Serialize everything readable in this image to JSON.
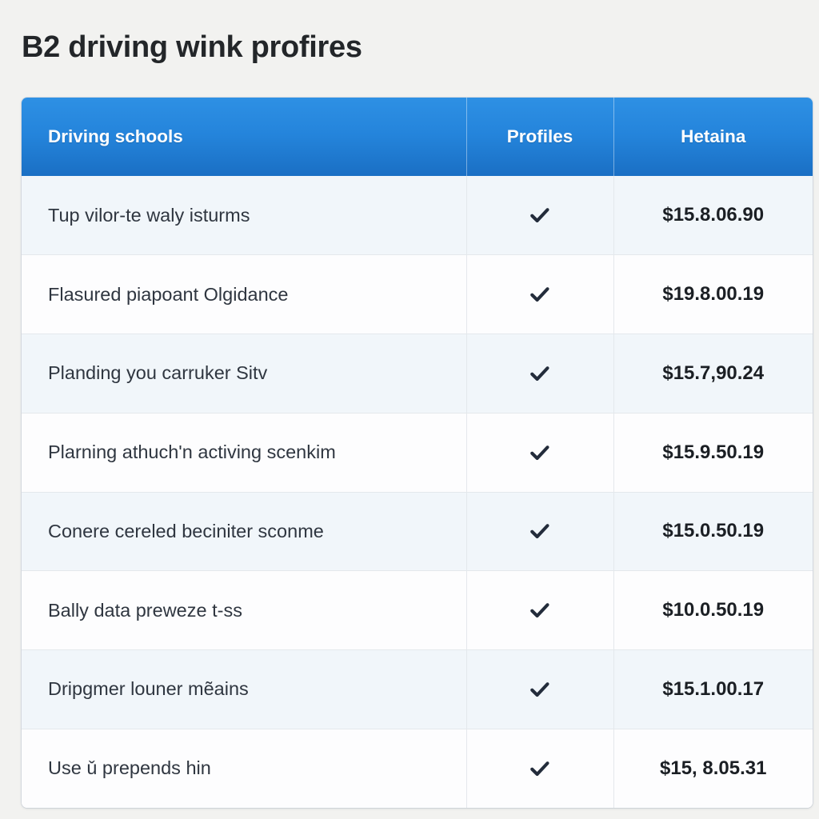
{
  "page": {
    "title": "B2 driving wink profires",
    "background_color": "#f2f2f0"
  },
  "table": {
    "accent_color": "#2484db",
    "header_text_color": "#ffffff",
    "stripe_color": "#f1f6fa",
    "row_color": "#fdfdfe",
    "check_icon_color": "#232c3b",
    "columns": [
      {
        "key": "name",
        "label": "Driving schools",
        "align": "left"
      },
      {
        "key": "profiles",
        "label": "Profiles",
        "align": "center"
      },
      {
        "key": "price",
        "label": "Hetaina",
        "align": "center"
      }
    ],
    "rows": [
      {
        "name": "Tup vilor-te waly isturms",
        "profiles_icon": "check-icon",
        "price": "$15.8.06.90"
      },
      {
        "name": "Flasured piapoant Olgidance",
        "profiles_icon": "check-icon",
        "price": "$19.8.00.19"
      },
      {
        "name": "Planding you carruker Sitv",
        "profiles_icon": "check-icon",
        "price": "$15.7,90.24"
      },
      {
        "name": "Plarning athuch'n activing scenkim",
        "profiles_icon": "check-icon",
        "price": "$15.9.50.19"
      },
      {
        "name": "Conere cereled beciniter sconme",
        "profiles_icon": "check-icon",
        "price": "$15.0.50.19"
      },
      {
        "name": "Bally data preweze t-ss",
        "profiles_icon": "check-icon",
        "price": "$10.0.50.19"
      },
      {
        "name": "Dripgmer louner mẽains",
        "profiles_icon": "check-icon",
        "price": "$15.1.00.17"
      },
      {
        "name": "Use ǔ prepends hin",
        "profiles_icon": "check-icon",
        "price": "$15, 8.05.31"
      }
    ]
  }
}
